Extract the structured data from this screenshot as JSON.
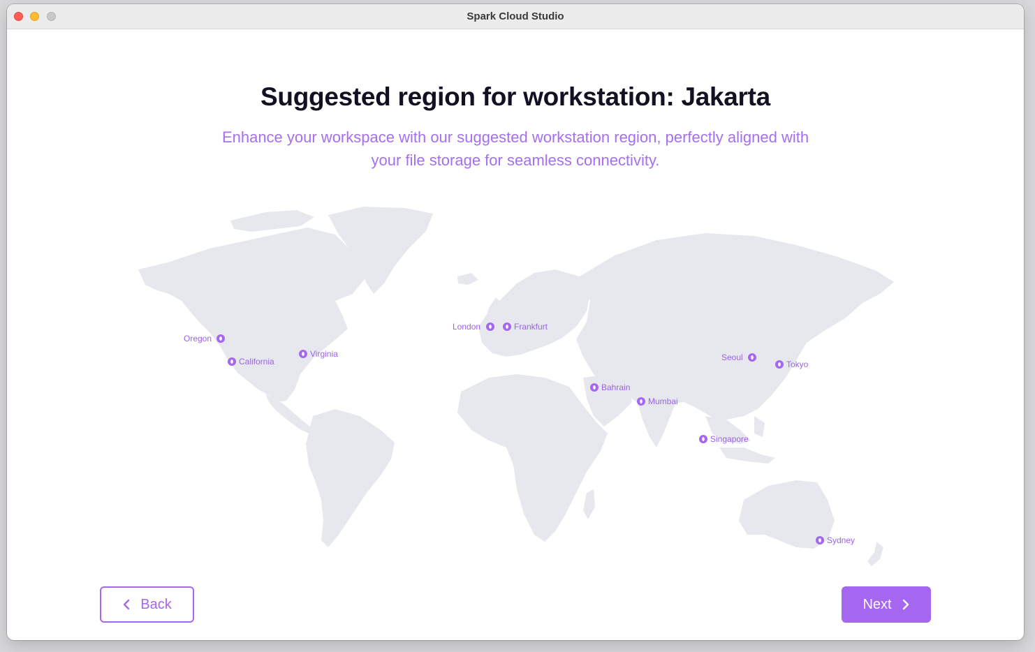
{
  "window": {
    "title": "Spark Cloud Studio"
  },
  "page": {
    "heading": "Suggested region for workstation: Jakarta",
    "subtitle_line1": "Enhance your workspace with our suggested workstation region, perfectly aligned with",
    "subtitle_line2": "your file storage for seamless connectivity."
  },
  "map": {
    "regions": [
      {
        "label": "Oregon"
      },
      {
        "label": "California"
      },
      {
        "label": "Virginia"
      },
      {
        "label": "London"
      },
      {
        "label": "Frankfurt"
      },
      {
        "label": "Bahrain"
      },
      {
        "label": "Mumbai"
      },
      {
        "label": "Seoul"
      },
      {
        "label": "Tokyo"
      },
      {
        "label": "Singapore"
      },
      {
        "label": "Sydney"
      }
    ]
  },
  "buttons": {
    "back": "Back",
    "next": "Next"
  },
  "icons": {
    "back": "chevron-left-icon",
    "next": "chevron-right-icon",
    "region_pin": "region-pin-icon"
  },
  "colors": {
    "accent": "#a566f0",
    "heading": "#111122",
    "land": "#e6e8ee"
  }
}
